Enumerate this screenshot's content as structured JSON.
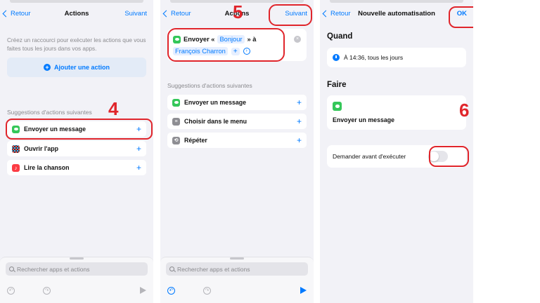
{
  "screen1": {
    "back": "Retour",
    "title": "Actions",
    "next": "Suivant",
    "hint": "Créez un raccourci pour exécuter les actions que vous faites tous les jours dans vos apps.",
    "add_action": "Ajouter une action",
    "suggestions_label": "Suggestions d'actions suivantes",
    "suggestions": [
      {
        "label": "Envoyer un message",
        "icon": "messages-icon"
      },
      {
        "label": "Ouvrir l'app",
        "icon": "app-grid-icon"
      },
      {
        "label": "Lire la chanson",
        "icon": "music-icon"
      }
    ],
    "search_placeholder": "Rechercher apps et actions",
    "step": "4"
  },
  "screen2": {
    "back": "Retour",
    "title": "Actions",
    "next": "Suivant",
    "action": {
      "verb": "Envoyer «",
      "message": "Bonjour",
      "connector": "» à",
      "recipient": "François Charron"
    },
    "suggestions_label": "Suggestions d'actions suivantes",
    "suggestions": [
      {
        "label": "Envoyer un message",
        "icon": "messages-icon"
      },
      {
        "label": "Choisir dans le menu",
        "icon": "menu-icon"
      },
      {
        "label": "Répéter",
        "icon": "repeat-icon"
      }
    ],
    "search_placeholder": "Rechercher apps et actions",
    "step": "5"
  },
  "screen3": {
    "back": "Retour",
    "title": "Nouvelle automatisation",
    "ok": "OK",
    "when_label": "Quand",
    "when_value": "À 14:36, tous les jours",
    "do_label": "Faire",
    "do_value": "Envoyer un message",
    "ask_label": "Demander avant d'exécuter",
    "ask_enabled": false,
    "step": "6"
  },
  "colors": {
    "accent": "#007aff",
    "annotation": "#e0252b",
    "messages": "#34c759"
  }
}
